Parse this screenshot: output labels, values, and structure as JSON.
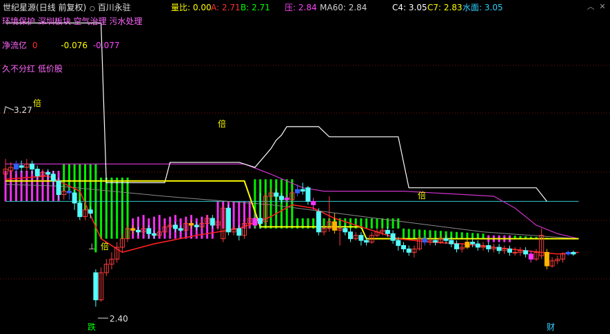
{
  "header": {
    "indicator_name": "世纪星源",
    "period": "(日线 前复权)",
    "stock_name": "百川永驻",
    "volume_ratio_label": "量比:",
    "volume_ratio_value": "0.00",
    "a_label": "A:",
    "a_value": "2.71",
    "b_label": "B:",
    "b_value": "2.71",
    "pressure_label": "压:",
    "pressure_value": "2.84",
    "ma60_label": "MA60:",
    "ma60_value": "2.84",
    "c4_label": "C4:",
    "c4_value": "3.05",
    "c7_label": "C7:",
    "c7_value": "2.83",
    "water_label": "水面:",
    "water_value": "3.05"
  },
  "concepts": "环境保护 深圳板块 空气治理 污水处理",
  "net_flow": {
    "label": "净流亿",
    "v1": "0",
    "v2": "-0.076",
    "v3": "-0.077"
  },
  "tags": "久不分红 低价股",
  "chart_labels": {
    "high_price": "3.27",
    "low_price": "2.40",
    "bei": "倍",
    "die": "跌",
    "cai": "财",
    "up_mark": "⊥"
  },
  "window_controls": [
    "minimize-icon",
    "close-icon"
  ],
  "colors": {
    "up": "#ff3c3c",
    "down": "#54ffff",
    "blue_candle": "#3060ff",
    "gold_candle": "#ffb400",
    "green_bar": "#00ff00",
    "magenta_bar": "#ff33ff",
    "yellow_line": "#ffff00",
    "white_line": "#ffffff",
    "purple_line": "#cc33cc",
    "cyan_line": "#33cccc",
    "ma_red": "#ff2020"
  },
  "chart_data": {
    "type": "candlestick",
    "y_axis": {
      "min": 2.3,
      "max": 4.1
    },
    "marked_high": 3.27,
    "marked_low": 2.4,
    "candles": [
      [
        3.18,
        3.21,
        3.14,
        3.27
      ],
      [
        3.2,
        3.22,
        3.16,
        3.25
      ],
      [
        3.21,
        3.24,
        3.18,
        3.26
      ],
      [
        3.23,
        3.22,
        3.19,
        3.26
      ],
      [
        3.22,
        3.24,
        3.2,
        3.27
      ],
      [
        3.24,
        3.21,
        3.18,
        3.26
      ],
      [
        3.21,
        3.17,
        3.15,
        3.23
      ],
      [
        3.17,
        3.19,
        3.14,
        3.21
      ],
      [
        3.19,
        3.18,
        3.15,
        3.21
      ],
      [
        3.18,
        3.14,
        3.11,
        3.2
      ],
      [
        3.14,
        3.06,
        3.03,
        3.16
      ],
      [
        3.06,
        3.08,
        3.03,
        3.11
      ],
      [
        3.08,
        3.07,
        3.03,
        3.1
      ],
      [
        3.07,
        3.01,
        2.97,
        3.09
      ],
      [
        3.01,
        2.93,
        2.91,
        3.03
      ],
      [
        2.93,
        2.97,
        2.91,
        3.0
      ],
      [
        2.97,
        2.95,
        2.92,
        2.99
      ],
      [
        2.6,
        2.44,
        2.4,
        2.62
      ],
      [
        2.44,
        2.6,
        2.43,
        2.63
      ],
      [
        2.6,
        2.65,
        2.58,
        2.68
      ],
      [
        2.65,
        2.68,
        2.62,
        2.72
      ],
      [
        2.68,
        2.75,
        2.66,
        2.78
      ],
      [
        2.75,
        2.8,
        2.72,
        2.83
      ],
      [
        2.8,
        2.86,
        2.78,
        2.88
      ],
      [
        2.86,
        2.85,
        2.83,
        2.88
      ],
      [
        2.85,
        2.84,
        2.82,
        2.87
      ],
      [
        2.84,
        2.86,
        2.82,
        2.88
      ],
      [
        2.86,
        2.83,
        2.8,
        2.88
      ],
      [
        2.83,
        2.82,
        2.8,
        2.85
      ],
      [
        2.82,
        2.84,
        2.81,
        2.86
      ],
      [
        2.84,
        2.87,
        2.83,
        2.89
      ],
      [
        2.87,
        2.88,
        2.85,
        2.9
      ],
      [
        2.88,
        2.86,
        2.84,
        2.9
      ],
      [
        2.86,
        2.85,
        2.84,
        2.88
      ],
      [
        2.85,
        2.89,
        2.84,
        2.91
      ],
      [
        2.89,
        2.88,
        2.86,
        2.91
      ],
      [
        2.88,
        2.87,
        2.85,
        2.9
      ],
      [
        2.87,
        2.89,
        2.86,
        2.91
      ],
      [
        2.89,
        2.92,
        2.88,
        2.94
      ],
      [
        2.92,
        2.88,
        2.86,
        2.94
      ],
      [
        2.88,
        2.9,
        2.85,
        2.92
      ],
      [
        2.8,
        2.98,
        2.78,
        3.0
      ],
      [
        2.98,
        2.84,
        2.82,
        3.0
      ],
      [
        2.84,
        2.86,
        2.82,
        2.88
      ],
      [
        2.86,
        2.82,
        2.79,
        2.88
      ],
      [
        2.82,
        2.89,
        2.8,
        2.9
      ],
      [
        2.89,
        2.92,
        2.87,
        2.93
      ],
      [
        2.92,
        2.88,
        2.86,
        2.95
      ],
      [
        2.92,
        2.89,
        2.86,
        3.07
      ],
      [
        2.9,
        3.05,
        2.88,
        3.07
      ],
      [
        3.05,
        3.07,
        3.03,
        3.1
      ],
      [
        3.07,
        3.05,
        3.02,
        3.09
      ],
      [
        3.05,
        3.03,
        3.01,
        3.07
      ],
      [
        3.03,
        3.04,
        3.01,
        3.06
      ],
      [
        3.03,
        3.07,
        3.02,
        3.09
      ],
      [
        3.07,
        3.09,
        3.05,
        3.12
      ],
      [
        3.09,
        3.08,
        3.06,
        3.13
      ],
      [
        3.1,
        3.02,
        3.0,
        3.11
      ],
      [
        3.02,
        3.0,
        2.97,
        3.04
      ],
      [
        2.96,
        2.84,
        2.82,
        2.98
      ],
      [
        2.84,
        2.86,
        2.82,
        2.88
      ],
      [
        2.86,
        2.9,
        2.84,
        3.05
      ],
      [
        2.9,
        2.85,
        2.83,
        2.95
      ],
      [
        2.85,
        2.86,
        2.76,
        2.88
      ],
      [
        2.86,
        2.84,
        2.82,
        2.88
      ],
      [
        2.84,
        2.8,
        2.78,
        2.86
      ],
      [
        2.8,
        2.82,
        2.79,
        2.84
      ],
      [
        2.82,
        2.79,
        2.76,
        2.84
      ],
      [
        2.79,
        2.78,
        2.76,
        2.81
      ],
      [
        2.78,
        2.82,
        2.77,
        2.84
      ],
      [
        2.82,
        2.84,
        2.81,
        2.86
      ],
      [
        2.84,
        2.85,
        2.82,
        2.87
      ],
      [
        2.85,
        2.83,
        2.81,
        2.87
      ],
      [
        2.83,
        2.79,
        2.77,
        2.85
      ],
      [
        2.79,
        2.76,
        2.73,
        2.81
      ],
      [
        2.76,
        2.74,
        2.72,
        2.78
      ],
      [
        2.74,
        2.72,
        2.7,
        2.76
      ],
      [
        2.72,
        2.74,
        2.69,
        2.76
      ],
      [
        2.74,
        2.8,
        2.73,
        2.82
      ],
      [
        2.8,
        2.78,
        2.76,
        2.82
      ],
      [
        2.78,
        2.79,
        2.76,
        2.81
      ],
      [
        2.79,
        2.78,
        2.76,
        2.8
      ],
      [
        2.78,
        2.8,
        2.77,
        2.82
      ],
      [
        2.8,
        2.79,
        2.77,
        2.82
      ],
      [
        2.79,
        2.77,
        2.75,
        2.81
      ],
      [
        2.77,
        2.74,
        2.72,
        2.79
      ],
      [
        2.74,
        2.75,
        2.72,
        2.77
      ],
      [
        2.75,
        2.78,
        2.74,
        2.8
      ],
      [
        2.78,
        2.77,
        2.75,
        2.8
      ],
      [
        2.77,
        2.75,
        2.73,
        2.79
      ],
      [
        2.75,
        2.76,
        2.73,
        2.78
      ],
      [
        2.76,
        2.74,
        2.72,
        2.78
      ],
      [
        2.74,
        2.75,
        2.72,
        2.77
      ],
      [
        2.75,
        2.73,
        2.71,
        2.77
      ],
      [
        2.73,
        2.74,
        2.71,
        2.76
      ],
      [
        2.74,
        2.72,
        2.7,
        2.76
      ],
      [
        2.72,
        2.72,
        2.7,
        2.75
      ],
      [
        2.72,
        2.73,
        2.7,
        2.75
      ],
      [
        2.73,
        2.71,
        2.69,
        2.75
      ],
      [
        2.71,
        2.68,
        2.66,
        2.73
      ],
      [
        2.68,
        2.72,
        2.67,
        2.74
      ],
      [
        2.7,
        2.82,
        2.68,
        2.86
      ],
      [
        2.72,
        2.64,
        2.62,
        2.74
      ],
      [
        2.64,
        2.67,
        2.63,
        2.69
      ],
      [
        2.67,
        2.68,
        2.65,
        2.7
      ],
      [
        2.68,
        2.71,
        2.66,
        2.72
      ],
      [
        2.71,
        2.72,
        2.7,
        2.73
      ],
      [
        2.72,
        2.71,
        2.7,
        2.73
      ]
    ],
    "special_candles": {
      "blue": [
        2,
        12,
        55,
        79,
        106
      ],
      "gold": [
        24,
        35,
        62,
        87,
        102
      ],
      "magenta_body": [
        47,
        53,
        58,
        99
      ]
    },
    "histogram": {
      "green": [
        0.55,
        0.6,
        0.7,
        0.8,
        0.9,
        1.0,
        1.0,
        1.0,
        1.0,
        0.95,
        0.9,
        0.85,
        0.8,
        0.7,
        0.6,
        0.5,
        0.45,
        0.4,
        0.35,
        0.3,
        0.25,
        0.2,
        0.18,
        0.15,
        0.12,
        0.1,
        0.08,
        0.07,
        0.06,
        0.05,
        0.05,
        0.05,
        0.05,
        0.05,
        0.05,
        0.05,
        0.05,
        0.05,
        0.05,
        0.05,
        0.05,
        0.05,
        0.05,
        0.05,
        0.05,
        0.05,
        0.05,
        0.05,
        0.05,
        0.05,
        0.05,
        0.05,
        0.05,
        0.05,
        0.05,
        0.05,
        0.05,
        0.05,
        0.05,
        0.05,
        0.05,
        0.05,
        0.05,
        0.05,
        0.05,
        0.05,
        0.05,
        0.05,
        0.05,
        0.05,
        0.05,
        0.05,
        0.05,
        0.05,
        0.05,
        0.05,
        0.05,
        0.05,
        0.05,
        0.05,
        0.05,
        0.05,
        0.05,
        0.05,
        0.05,
        0.05,
        0.05,
        0.05,
        0.05,
        0.05,
        0.05,
        0.05,
        0.05,
        0.05,
        0.05,
        0.05,
        0.05,
        0.05,
        0.05,
        0.05,
        0.05,
        0.05,
        0.05,
        0.05,
        0.05,
        0.05,
        0.05,
        0.05,
        0.05,
        0.05
      ],
      "magenta": []
    },
    "yellow_line": [
      [
        0,
        3.14
      ],
      [
        45,
        3.14
      ],
      [
        48,
        2.87
      ],
      [
        67,
        2.87
      ],
      [
        68,
        2.8
      ],
      [
        108,
        2.8
      ]
    ],
    "white_line": [
      [
        0,
        4.07
      ],
      [
        18,
        4.07
      ],
      [
        19,
        3.13
      ],
      [
        30,
        3.13
      ],
      [
        31,
        3.25
      ],
      [
        44,
        3.25
      ],
      [
        47,
        3.22
      ],
      [
        50,
        3.33
      ],
      [
        51,
        3.38
      ],
      [
        52,
        3.41
      ],
      [
        53,
        3.46
      ],
      [
        59,
        3.46
      ],
      [
        61,
        3.4
      ],
      [
        74,
        3.4
      ],
      [
        76,
        3.1
      ],
      [
        100,
        3.1
      ],
      [
        102,
        3.02
      ]
    ],
    "purple_line": [
      [
        0,
        3.24
      ],
      [
        45,
        3.24
      ],
      [
        50,
        3.18
      ],
      [
        56,
        3.1
      ],
      [
        60,
        3.08
      ],
      [
        75,
        3.08
      ],
      [
        92,
        3.05
      ],
      [
        96,
        2.98
      ],
      [
        100,
        2.88
      ],
      [
        104,
        2.83
      ],
      [
        108,
        2.8
      ]
    ],
    "cyan_line": [
      [
        0,
        3.02
      ],
      [
        108,
        3.02
      ]
    ],
    "gray_line": [
      [
        0,
        3.12
      ],
      [
        10,
        3.11
      ],
      [
        30,
        3.05
      ],
      [
        50,
        3.0
      ],
      [
        70,
        2.92
      ],
      [
        90,
        2.84
      ],
      [
        108,
        2.8
      ]
    ],
    "ma_red": [
      [
        0,
        3.15
      ],
      [
        8,
        3.17
      ],
      [
        14,
        3.08
      ],
      [
        18,
        2.8
      ],
      [
        22,
        2.72
      ],
      [
        28,
        2.77
      ],
      [
        36,
        2.82
      ],
      [
        44,
        2.86
      ],
      [
        50,
        2.93
      ],
      [
        54,
        3.0
      ],
      [
        58,
        2.98
      ],
      [
        62,
        2.92
      ],
      [
        68,
        2.86
      ],
      [
        74,
        2.8
      ],
      [
        80,
        2.78
      ],
      [
        86,
        2.77
      ],
      [
        92,
        2.75
      ],
      [
        98,
        2.73
      ],
      [
        104,
        2.71
      ],
      [
        108,
        2.72
      ]
    ]
  }
}
